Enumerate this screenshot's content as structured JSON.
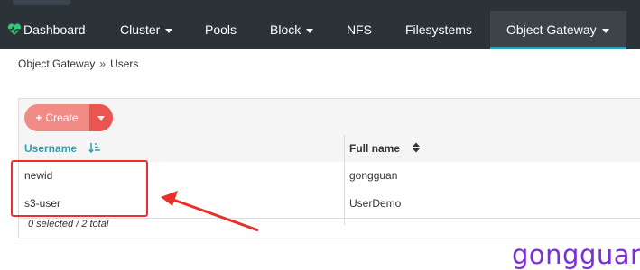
{
  "nav": {
    "items": [
      {
        "label": "Dashboard",
        "icon": "heart-pulse-icon"
      },
      {
        "label": "Cluster",
        "dropdown": true
      },
      {
        "label": "Pools"
      },
      {
        "label": "Block",
        "dropdown": true
      },
      {
        "label": "NFS"
      },
      {
        "label": "Filesystems"
      },
      {
        "label": "Object Gateway",
        "dropdown": true,
        "active": true
      }
    ],
    "accent_color": "#29a2b6",
    "background_color": "#2b3238"
  },
  "breadcrumb": {
    "parent": "Object Gateway",
    "separator": "»",
    "current": "Users"
  },
  "toolbar": {
    "create_label": "Create",
    "create_color": "#f28a86"
  },
  "table": {
    "columns": [
      {
        "label": "Username",
        "sorted": "ascending"
      },
      {
        "label": "Full name",
        "sortable": true
      }
    ],
    "rows": [
      {
        "username": "newid",
        "full_name": "gongguan"
      },
      {
        "username": "s3-user",
        "full_name": "UserDemo"
      }
    ],
    "footer": "0 selected / 2 total"
  },
  "annotation": {
    "color": "#e8302a"
  },
  "watermark": "gongguan"
}
